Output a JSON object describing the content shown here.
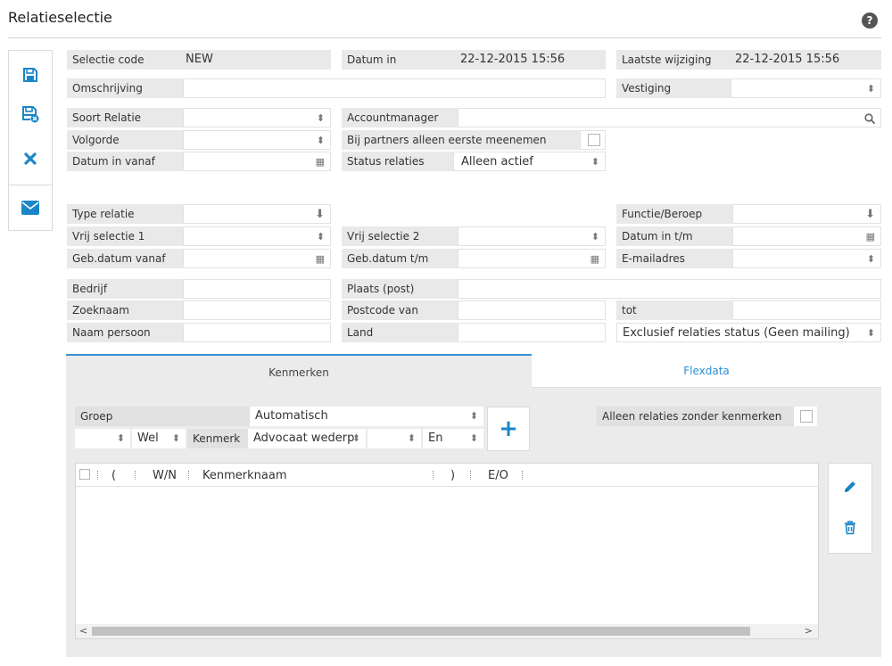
{
  "page": {
    "title": "Relatieselectie",
    "help": "?"
  },
  "sidebar": {
    "save": "save-icon",
    "save_close": "save-close-icon",
    "cancel": "close-icon",
    "mail": "mail-icon"
  },
  "form": {
    "selectie_code": {
      "label": "Selectie code",
      "value": "NEW"
    },
    "datum_in": {
      "label": "Datum in",
      "value": "22-12-2015 15:56"
    },
    "laatste_wijziging": {
      "label": "Laatste wijziging",
      "value": "22-12-2015 15:56"
    },
    "omschrijving": {
      "label": "Omschrijving",
      "value": ""
    },
    "vestiging": {
      "label": "Vestiging",
      "value": ""
    },
    "soort_relatie": {
      "label": "Soort Relatie",
      "value": ""
    },
    "accountmanager": {
      "label": "Accountmanager",
      "value": ""
    },
    "volgorde": {
      "label": "Volgorde",
      "value": ""
    },
    "bij_partners": {
      "label": "Bij partners alleen eerste meenemen"
    },
    "datum_in_vanaf": {
      "label": "Datum in vanaf",
      "value": ""
    },
    "status_relaties": {
      "label": "Status relaties",
      "value": "Alleen actief"
    },
    "type_relatie": {
      "label": "Type relatie",
      "value": ""
    },
    "functie_beroep": {
      "label": "Functie/Beroep",
      "value": ""
    },
    "vrij_selectie_1": {
      "label": "Vrij selectie 1",
      "value": ""
    },
    "vrij_selectie_2": {
      "label": "Vrij selectie 2",
      "value": ""
    },
    "datum_in_tm": {
      "label": "Datum in t/m",
      "value": ""
    },
    "geb_datum_vanaf": {
      "label": "Geb.datum vanaf",
      "value": ""
    },
    "geb_datum_tm": {
      "label": "Geb.datum t/m",
      "value": ""
    },
    "emailadres": {
      "label": "E-mailadres",
      "value": ""
    },
    "bedrijf": {
      "label": "Bedrijf",
      "value": ""
    },
    "plaats_post": {
      "label": "Plaats (post)",
      "value": ""
    },
    "zoeknaam": {
      "label": "Zoeknaam",
      "value": ""
    },
    "postcode_van": {
      "label": "Postcode van",
      "value": ""
    },
    "tot": {
      "label": "tot",
      "value": ""
    },
    "naam_persoon": {
      "label": "Naam persoon",
      "value": ""
    },
    "land": {
      "label": "Land",
      "value": ""
    },
    "exclusief_status": {
      "value": "Exclusief relaties status (Geen mailing)"
    }
  },
  "tabs": [
    {
      "label": "Kenmerken"
    },
    {
      "label": "Flexdata"
    }
  ],
  "kenmerken": {
    "groep_label": "Groep",
    "groep_value": "Automatisch",
    "alleen_zonder_label": "Alleen relaties zonder kenmerken",
    "wel_value": "Wel",
    "kenmerk_label": "Kenmerk",
    "kenmerk_value": "Advocaat wederp",
    "en_value": "En",
    "grid_headers": {
      "open": "(",
      "wn": "W/N",
      "kenmerknaam": "Kenmerknaam",
      "close": ")",
      "eo": "E/O"
    },
    "scroll_left": "<",
    "scroll_right": ">"
  }
}
